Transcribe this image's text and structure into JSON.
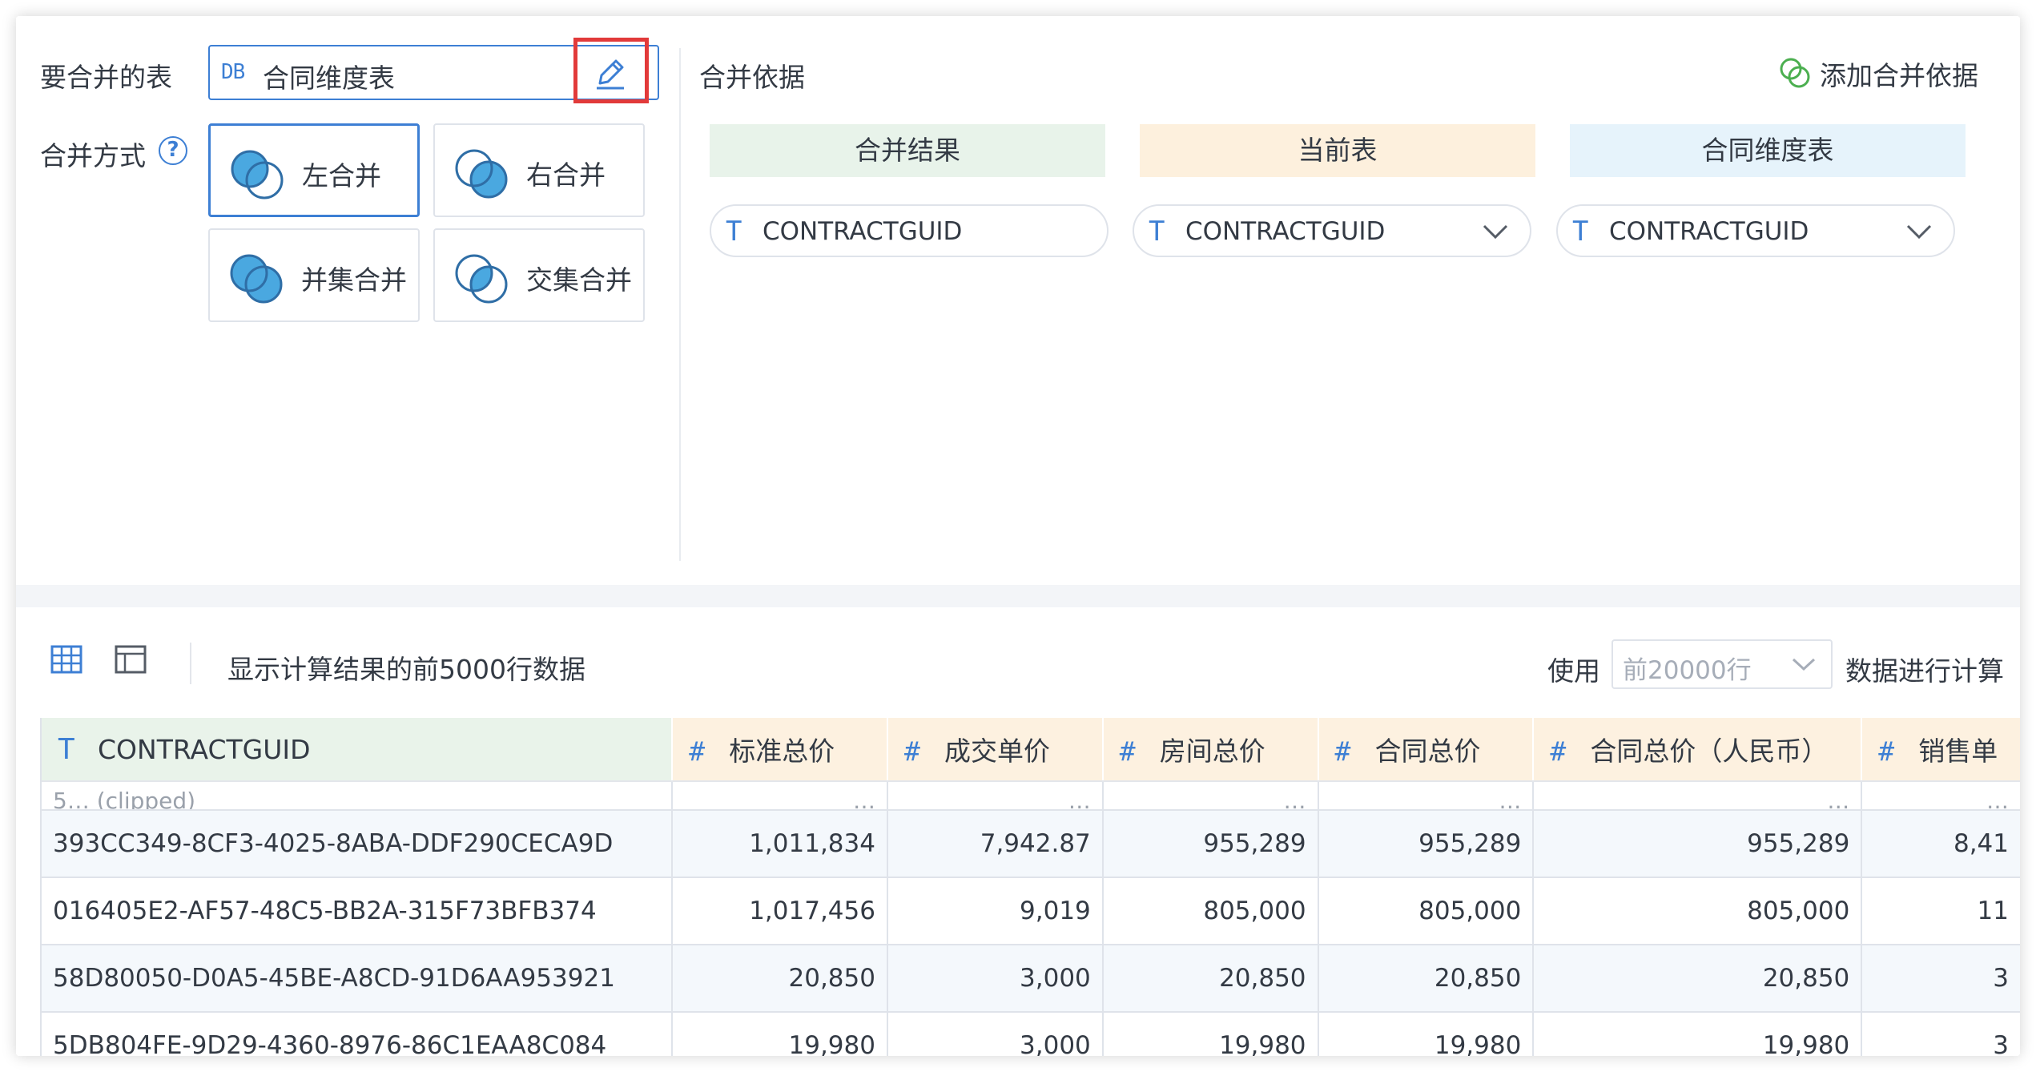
{
  "config": {
    "table_label": "要合并的表",
    "table_db_tag": "DB",
    "table_name": "合同维度表",
    "mode_label": "合并方式",
    "help_glyph": "?",
    "modes": [
      {
        "label": "左合并",
        "active": true
      },
      {
        "label": "右合并",
        "active": false
      },
      {
        "label": "并集合并",
        "active": false
      },
      {
        "label": "交集合并",
        "active": false
      }
    ],
    "basis_label": "合并依据",
    "add_basis_label": "添加合并依据",
    "headers": {
      "result": "合并结果",
      "current": "当前表",
      "target": "合同维度表"
    },
    "header_colors": {
      "result": "#e8f3ea",
      "current": "#fdf0dd",
      "target": "#e6f3fb"
    },
    "fields": {
      "type_glyph": "T",
      "result": "CONTRACTGUID",
      "current": "CONTRACTGUID",
      "target": "CONTRACTGUID"
    }
  },
  "preview": {
    "caption": "显示计算结果的前5000行数据",
    "use_label": "使用",
    "rows_option": "前20000行",
    "calc_label": "数据进行计算",
    "columns": [
      {
        "sym": "T",
        "name": "CONTRACTGUID"
      },
      {
        "sym": "#",
        "name": "标准总价"
      },
      {
        "sym": "#",
        "name": "成交单价"
      },
      {
        "sym": "#",
        "name": "房间总价"
      },
      {
        "sym": "#",
        "name": "合同总价"
      },
      {
        "sym": "#",
        "name": "合同总价（人民币）"
      },
      {
        "sym": "#",
        "name": "销售单"
      }
    ],
    "partial_row": [
      "5… (clipped)",
      "…",
      "…",
      "…",
      "…",
      "…",
      "…"
    ],
    "rows": [
      [
        "393CC349-8CF3-4025-8ABA-DDF290CECA9D",
        "1,011,834",
        "7,942.87",
        "955,289",
        "955,289",
        "955,289",
        "8,41"
      ],
      [
        "016405E2-AF57-48C5-BB2A-315F73BFB374",
        "1,017,456",
        "9,019",
        "805,000",
        "805,000",
        "805,000",
        "11"
      ],
      [
        "58D80050-D0A5-45BE-A8CD-91D6AA953921",
        "20,850",
        "3,000",
        "20,850",
        "20,850",
        "20,850",
        "3"
      ],
      [
        "5DB804FE-9D29-4360-8976-86C1EAA8C084",
        "19,980",
        "3,000",
        "19,980",
        "19,980",
        "19,980",
        "3"
      ]
    ]
  },
  "colors": {
    "accent": "#3d7fd4",
    "highlight": "#e23a3a",
    "add_icon": "#4caf50"
  }
}
